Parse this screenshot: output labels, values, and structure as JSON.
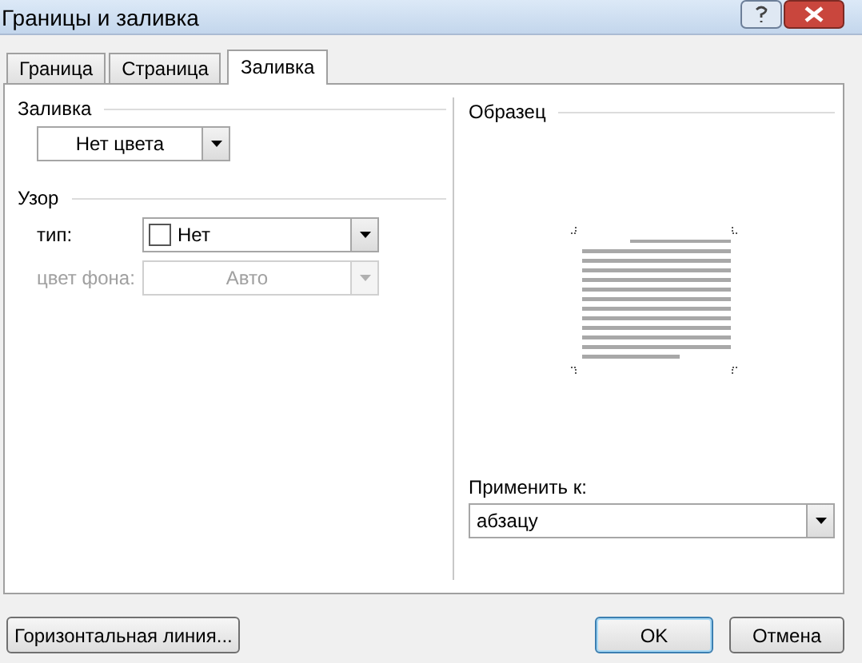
{
  "window": {
    "title": "Границы и заливка"
  },
  "tabs": [
    {
      "label": "Граница",
      "selected": false
    },
    {
      "label": "Страница",
      "selected": false
    },
    {
      "label": "Заливка",
      "selected": true
    }
  ],
  "fill": {
    "label": "Заливка",
    "value": "Нет цвета"
  },
  "pattern": {
    "label": "Узор",
    "fields": [
      {
        "label": "тип:",
        "value": "Нет",
        "disabled": false,
        "swatch": true
      },
      {
        "label": "цвет фона:",
        "value": "Авто",
        "disabled": true,
        "swatch": false
      }
    ]
  },
  "preview": {
    "label": "Образец"
  },
  "apply_to": {
    "label": "Применить к:",
    "value": "абзацу"
  },
  "buttons": [
    {
      "label": "Горизонтальная линия...",
      "default": false
    },
    {
      "label": "OK",
      "default": true
    },
    {
      "label": "Отмена",
      "default": false
    }
  ]
}
